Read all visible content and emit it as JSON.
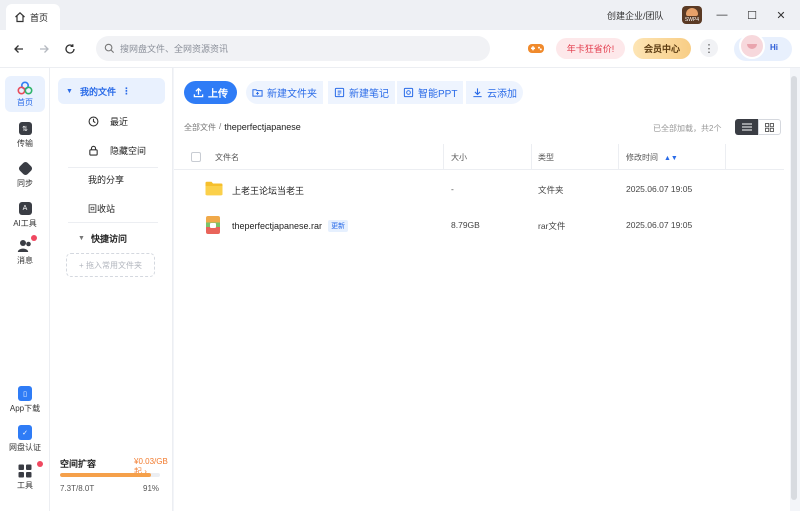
{
  "titlebar": {
    "tab_label": "首页",
    "enterprise_label": "创建企业/团队",
    "badge_text": "SWP4",
    "minimize": "—",
    "maximize": "☐",
    "close": "✕"
  },
  "nav": {
    "search_placeholder": "搜网盘文件、全网资源资讯",
    "promo_label": "年卡狂省价!",
    "vip_label": "会员中心",
    "more_label": "⋮",
    "hi_label": "Hi"
  },
  "rail": {
    "items": [
      {
        "label": "首页"
      },
      {
        "label": "传输"
      },
      {
        "label": "同步"
      },
      {
        "label": "AI工具"
      },
      {
        "label": "消息"
      }
    ],
    "bottom": [
      {
        "label": "App下载"
      },
      {
        "label": "网盘认证"
      },
      {
        "label": "工具"
      }
    ]
  },
  "side": {
    "my_files": "我的文件",
    "recent": "最近",
    "hidden_space": "隐藏空间",
    "my_share": "我的分享",
    "recycle": "回收站",
    "quick_access": "快捷访问",
    "add_fav": "+ 拖入常用文件夹",
    "storage": {
      "title": "空间扩容",
      "price": "¥0.03/GB起 ›",
      "usage": "7.3T/8.0T",
      "percent_label": "91%",
      "fraction": 0.91
    }
  },
  "main": {
    "upload": "上传",
    "tools": [
      "新建文件夹",
      "新建笔记",
      "智能PPT",
      "云添加"
    ],
    "breadcrumb_root": "全部文件",
    "breadcrumb_sep": "/",
    "breadcrumb_current": "theperfectjapanese",
    "loaded_text": "已全部加载，共2个",
    "columns": {
      "name": "文件名",
      "size": "大小",
      "type": "类型",
      "modified": "修改时间"
    },
    "rows": [
      {
        "name": "上老王论坛当老王",
        "size": "-",
        "type": "文件夹",
        "modified": "2025.06.07 19:05",
        "badge": ""
      },
      {
        "name": "theperfectjapanese.rar",
        "size": "8.79GB",
        "type": "rar文件",
        "modified": "2025.06.07 19:05",
        "badge": "更新"
      }
    ]
  }
}
